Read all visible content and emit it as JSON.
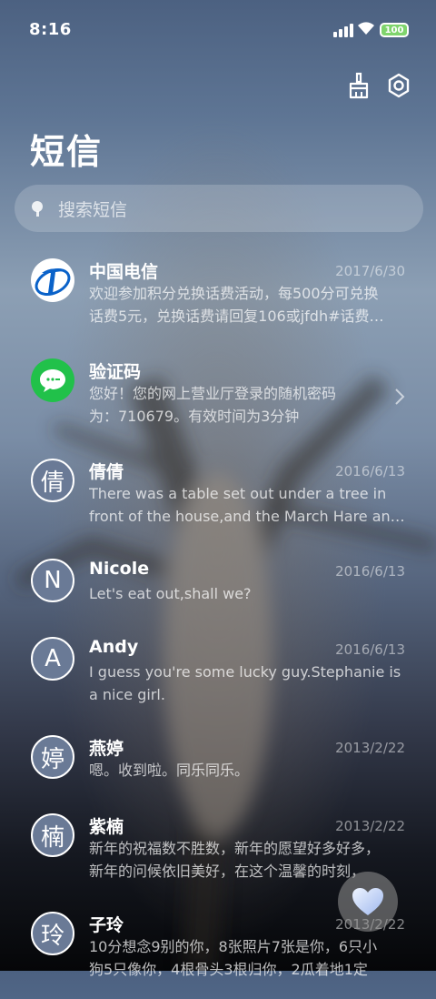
{
  "status_bar": {
    "time": "8:16",
    "battery": "100"
  },
  "header": {
    "title": "短信"
  },
  "search": {
    "placeholder": "搜索短信"
  },
  "conversations": [
    {
      "name": "中国电信",
      "date": "2017/6/30",
      "line1": "欢迎参加积分兑换话费活动，每500分可兑换",
      "line2": "话费5元，兑换话费请回复106或jfdh#话费…",
      "avatar_type": "telecom-logo"
    },
    {
      "name": "验证码",
      "date": "",
      "line1": "您好！您的网上营业厅登录的随机密码",
      "line2": "为：710679。有效时间为3分钟",
      "avatar_type": "sms-bubble"
    },
    {
      "name": "倩倩",
      "date": "2016/6/13",
      "line1": "There was a table set out under a tree in",
      "line2": "front of the house,and the March Hare an…",
      "avatar_letter": "倩"
    },
    {
      "name": "Nicole",
      "date": "2016/6/13",
      "line1": "Let's eat out,shall we?",
      "line2": "",
      "avatar_letter": "N"
    },
    {
      "name": "Andy",
      "date": "2016/6/13",
      "line1": "I guess you're some lucky guy.Stephanie is",
      "line2": "a nice girl.",
      "avatar_letter": "A"
    },
    {
      "name": "燕婷",
      "date": "2013/2/22",
      "line1": "嗯。收到啦。同乐同乐。",
      "line2": "",
      "avatar_letter": "婷"
    },
    {
      "name": "紫楠",
      "date": "2013/2/22",
      "line1": "新年的祝福数不胜数，新年的愿望好多好多，",
      "line2": "新年的问候依旧美好，在这个温馨的时刻，",
      "avatar_letter": "楠"
    },
    {
      "name": "子玲",
      "date": "2013/2/22",
      "line1": "10分想念9别的你，8张照片7张是你，6只小",
      "line2": "狗5只像你，4根骨头3根归你，2瓜着地1定",
      "avatar_letter": "玲"
    }
  ],
  "colors": {
    "accent_green": "#21c14a",
    "telecom_blue": "#0a62c9",
    "battery_green": "#7fd46d"
  }
}
